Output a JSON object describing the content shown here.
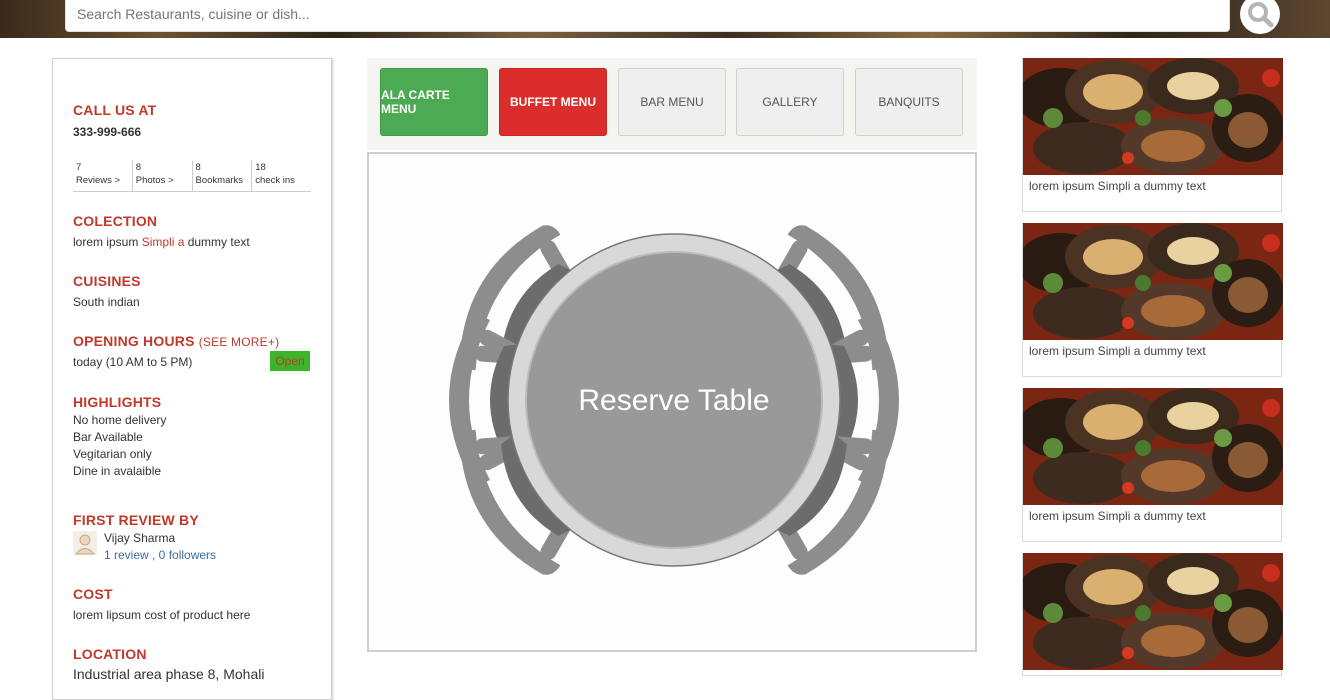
{
  "search": {
    "placeholder": "Search Restaurants, cuisine or dish..."
  },
  "sidebar": {
    "call": {
      "heading": "CALL US AT",
      "phone": "333-999-666"
    },
    "stats": [
      {
        "count": "7",
        "label": "Reviews >"
      },
      {
        "count": "8",
        "label": "Photos >"
      },
      {
        "count": "8",
        "label": "Bookmarks"
      },
      {
        "count": "18",
        "label": "check ins"
      }
    ],
    "collection": {
      "heading": "COLECTION",
      "text_before": "lorem ipsum ",
      "highlight": "Simpli a",
      "text_after": " dummy text"
    },
    "cuisines": {
      "heading": "CUISINES",
      "value": "South indian"
    },
    "hours": {
      "heading": "OPENING HOURS",
      "see_more": "(SEE MORE+)",
      "value": "today (10 AM to 5 PM)",
      "status": "Open"
    },
    "highlights": {
      "heading": "HIGHLIGHTS",
      "items": [
        "No home delivery",
        "Bar Available",
        "Vegitarian only",
        "Dine in avalaible"
      ]
    },
    "first_review": {
      "heading": "FIRST REVIEW BY",
      "name": "Vijay Sharma",
      "meta": "1 review , 0 followers"
    },
    "cost": {
      "heading": "COST",
      "value": "lorem lipsum cost of product here"
    },
    "location": {
      "heading": "LOCATION",
      "value": "Industrial area phase 8, Mohali"
    }
  },
  "menu_tabs": [
    {
      "label": "ALA CARTE MENU",
      "style": "green"
    },
    {
      "label": "BUFFET MENU",
      "style": "red"
    },
    {
      "label": "BAR MENU",
      "style": "grey"
    },
    {
      "label": "GALLERY",
      "style": "grey"
    },
    {
      "label": "BANQUITS",
      "style": "grey"
    }
  ],
  "reserve": {
    "label": "Reserve Table"
  },
  "cards": [
    {
      "caption": "lorem ipsum Simpli a dummy text"
    },
    {
      "caption": "lorem ipsum Simpli a dummy text"
    },
    {
      "caption": "lorem ipsum Simpli a dummy text"
    },
    {
      "caption": ""
    }
  ],
  "colors": {
    "accent": "#c0392b",
    "green": "#4caa53",
    "red": "#dc2d2d",
    "link": "#3a6ea5",
    "open": "#3cb52a"
  }
}
